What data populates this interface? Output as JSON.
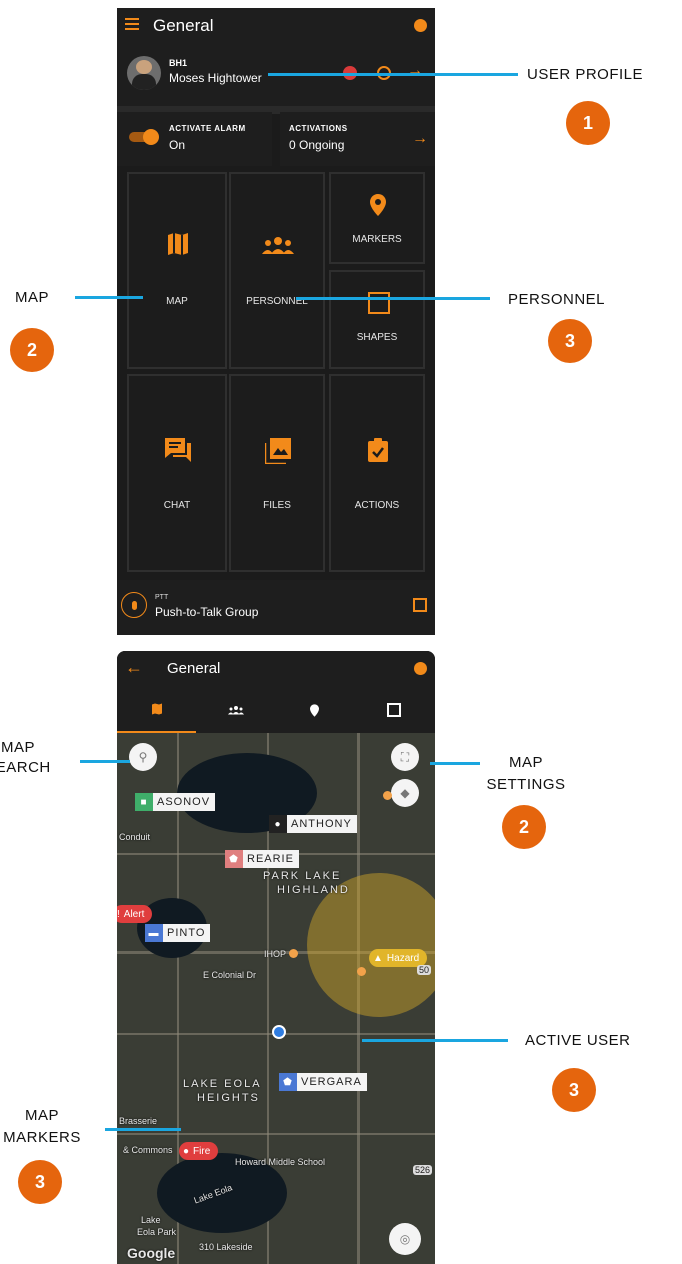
{
  "phone1": {
    "header": {
      "title": "General"
    },
    "user": {
      "callsign": "BH1",
      "name": "Moses Hightower"
    },
    "alarm": {
      "label": "ACTIVATE ALARM",
      "state": "On"
    },
    "activations": {
      "label": "ACTIVATIONS",
      "value": "0 Ongoing"
    },
    "tiles": {
      "map": "MAP",
      "personnel": "PERSONNEL",
      "markers": "MARKERS",
      "shapes": "SHAPES",
      "chat": "CHAT",
      "files": "FILES",
      "actions": "ACTIONS"
    },
    "ptt": {
      "label": "PTT",
      "group": "Push-to-Talk Group"
    }
  },
  "phone2": {
    "header": {
      "title": "General"
    },
    "markers": {
      "asonov": "ASONOV",
      "anthony": "ANTHONY",
      "rearie": "REARIE",
      "pinto": "PINTO",
      "vergara": "VERGARA"
    },
    "labels": {
      "alert": "Alert",
      "hazard": "Hazard",
      "fire": "Fire"
    },
    "places": {
      "conduit": "Conduit",
      "park_lake": "PARK LAKE",
      "highland": "HIGHLAND",
      "ihop": "IHOP",
      "colonial": "E Colonial Dr",
      "lake_eola": "LAKE EOLA",
      "heights": "HEIGHTS",
      "brasserie": "Brasserie",
      "commons": "& Commons",
      "howard": "Howard Middle School",
      "lake_eola_water": "Lake Eola",
      "eola_park": "Eola Park",
      "lake_label": "Lake",
      "lakeside": "310 Lakeside",
      "google": "Google",
      "road_50": "50",
      "road_526": "526"
    }
  },
  "callouts": {
    "user_profile": {
      "label": "USER PROFILE",
      "num": "1"
    },
    "map": {
      "label": "MAP",
      "num": "2"
    },
    "personnel": {
      "label": "PERSONNEL",
      "num": "3"
    },
    "map_search": {
      "line1": "MAP",
      "line2": "SEARCH"
    },
    "map_settings": {
      "line1": "MAP",
      "line2": "SETTINGS",
      "num": "2"
    },
    "active_user": {
      "label": "ACTIVE USER",
      "num": "3"
    },
    "map_markers": {
      "line1": "MAP",
      "line2": "MARKERS",
      "num": "3"
    }
  },
  "colors": {
    "accent": "#f28a1a",
    "callout_line": "#1aa6e0",
    "badge": "#e5650d"
  }
}
